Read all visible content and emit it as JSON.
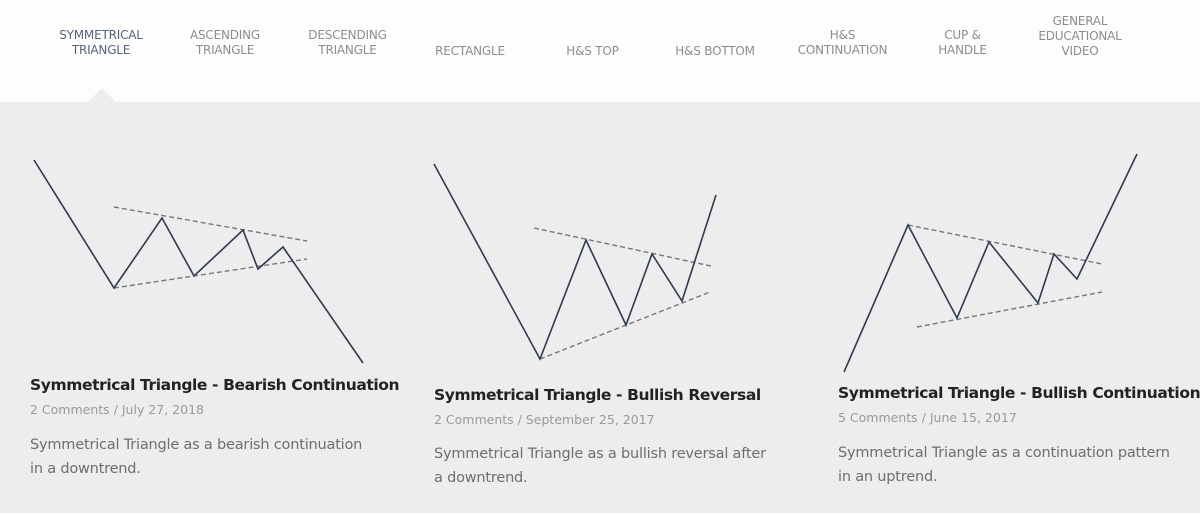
{
  "nav": {
    "tabs": [
      {
        "lines": [
          "SYMMETRICAL",
          "TRIANGLE"
        ],
        "active": true
      },
      {
        "lines": [
          "ASCENDING",
          "TRIANGLE"
        ],
        "active": false
      },
      {
        "lines": [
          "DESCENDING",
          "TRIANGLE"
        ],
        "active": false
      },
      {
        "lines": [
          "RECTANGLE"
        ],
        "active": false
      },
      {
        "lines": [
          "H&S TOP"
        ],
        "active": false
      },
      {
        "lines": [
          "H&S BOTTOM"
        ],
        "active": false
      },
      {
        "lines": [
          "H&S",
          "CONTINUATION"
        ],
        "active": false
      },
      {
        "lines": [
          "CUP &",
          "HANDLE"
        ],
        "active": false
      },
      {
        "lines": [
          "GENERAL",
          "EDUCATIONAL",
          "VIDEO"
        ],
        "active": false
      }
    ]
  },
  "posts": [
    {
      "title": "Symmetrical Triangle - Bearish Continuation",
      "comments": "2 Comments",
      "separator": " / ",
      "date": "July 27, 2018",
      "description": "Symmetrical Triangle as a bearish continuation in a downtrend.",
      "illustration": "bearish-continuation-triangle"
    },
    {
      "title": "Symmetrical Triangle - Bullish Reversal",
      "comments": "2 Comments",
      "separator": " / ",
      "date": "September 25, 2017",
      "description": "Symmetrical Triangle as a bullish reversal after a downtrend.",
      "illustration": "bullish-reversal-triangle"
    },
    {
      "title": "Symmetrical Triangle - Bullish Continuation",
      "comments": "5 Comments",
      "separator": " / ",
      "date": "June 15, 2017",
      "description": "Symmetrical Triangle as a continuation pattern in an uptrend.",
      "illustration": "bullish-continuation-triangle"
    }
  ],
  "colors": {
    "nav_bg": "#fdfdfd",
    "content_bg": "#ededed",
    "active_tab": "#56657a",
    "inactive_tab": "#8d8d8d",
    "price_line": "#2e3a4e",
    "trendline": "#777777"
  }
}
